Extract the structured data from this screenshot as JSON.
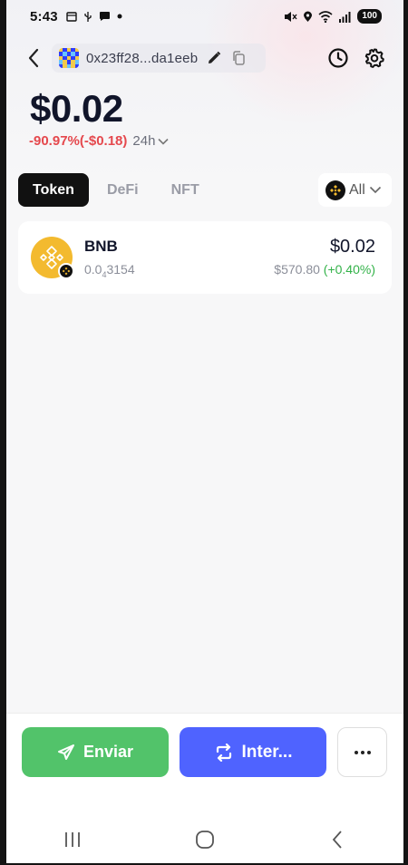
{
  "status_bar": {
    "time": "5:43",
    "battery": "100"
  },
  "header": {
    "address": "0x23ff28...da1eeb"
  },
  "balance": {
    "total": "$0.02",
    "change": "-90.97%(-$0.18)",
    "period": "24h"
  },
  "tabs": [
    {
      "label": "Token",
      "active": true
    },
    {
      "label": "DeFi",
      "active": false
    },
    {
      "label": "NFT",
      "active": false
    }
  ],
  "filter": {
    "label": "All"
  },
  "tokens": [
    {
      "symbol": "BNB",
      "amount_prefix": "0.0",
      "amount_zeros": "4",
      "amount_suffix": "3154",
      "value": "$0.02",
      "price": "$570.80",
      "price_change": "(+0.40%)"
    }
  ],
  "actions": {
    "send": "Enviar",
    "swap": "Inter..."
  },
  "colors": {
    "accent_green": "#52c36a",
    "accent_blue": "#4f63ff",
    "negative": "#e5484d",
    "positive": "#33b249",
    "bnb_yellow": "#f3ba2f"
  }
}
